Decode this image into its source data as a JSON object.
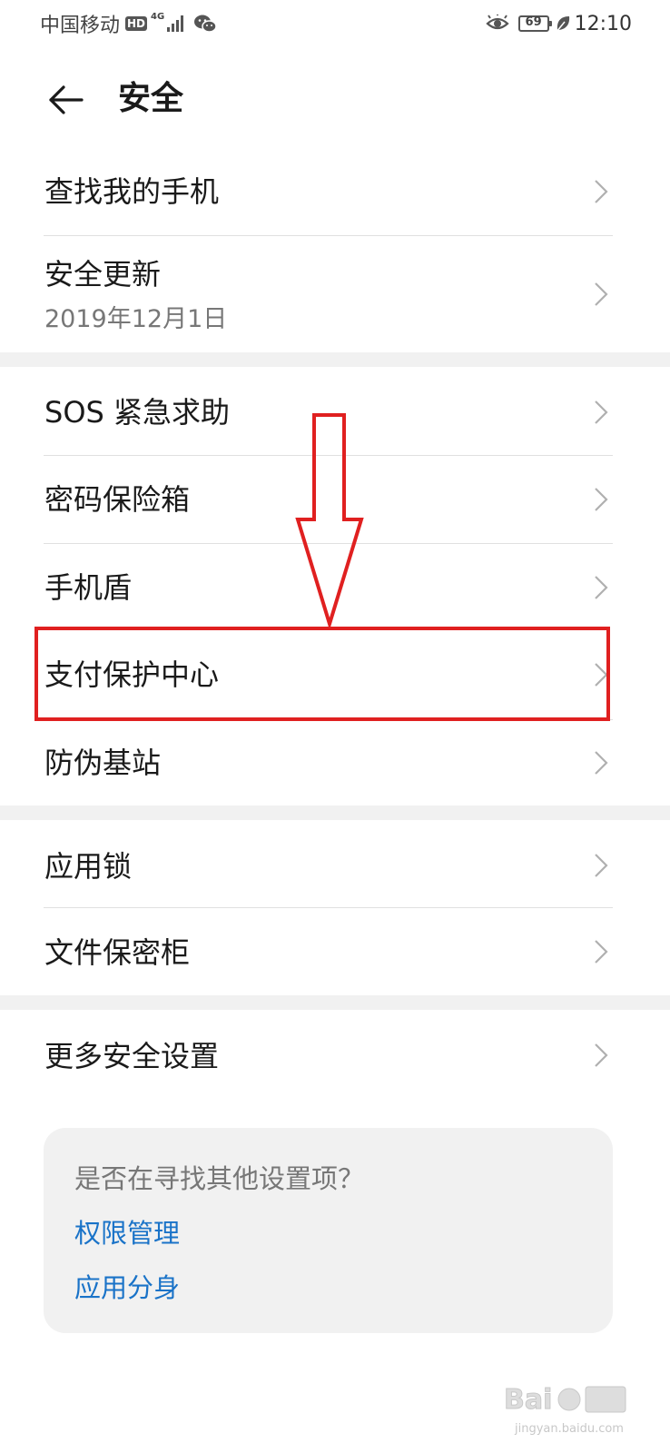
{
  "status_bar": {
    "carrier": "中国移动",
    "hd_badge": "HD",
    "network": "4G",
    "battery": "69",
    "time": "12:10"
  },
  "header": {
    "title": "安全"
  },
  "items": [
    {
      "label": "查找我的手机"
    },
    {
      "label": "安全更新",
      "sub": "2019年12月1日"
    },
    {
      "label": "SOS 紧急求助"
    },
    {
      "label": "密码保险箱"
    },
    {
      "label": "手机盾"
    },
    {
      "label": "支付保护中心"
    },
    {
      "label": "防伪基站"
    },
    {
      "label": "应用锁"
    },
    {
      "label": "文件保密柜"
    },
    {
      "label": "更多安全设置"
    }
  ],
  "suggestions": {
    "title": "是否在寻找其他设置项？",
    "links": [
      "权限管理",
      "应用分身"
    ]
  },
  "colors": {
    "link": "#1a73c8",
    "annotation": "#e02020",
    "section_gap": "#f1f1f1"
  },
  "icons": {
    "back": "arrow-left-icon",
    "chevron": "chevron-right-icon"
  }
}
